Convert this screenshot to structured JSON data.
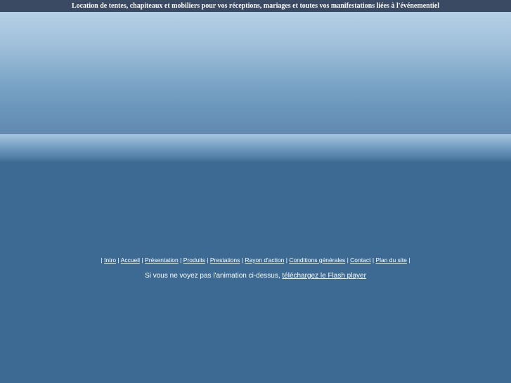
{
  "header": {
    "tagline": "Location de tentes, chapiteaux et mobiliers pour vos réceptions, mariages et toutes vos manifestations liées à l'événementiel"
  },
  "nav": {
    "separator": "|",
    "items": [
      {
        "label": "Intro"
      },
      {
        "label": "Accueil"
      },
      {
        "label": "Présentation"
      },
      {
        "label": "Produits"
      },
      {
        "label": "Prestations"
      },
      {
        "label": "Rayon d'action"
      },
      {
        "label": "Conditions générales"
      },
      {
        "label": "Contact"
      },
      {
        "label": "Plan du site"
      }
    ]
  },
  "flash": {
    "text": "Si vous ne voyez pas l'animation ci-dessus,",
    "link_label": "téléchargez le Flash player"
  },
  "colors": {
    "top_bar": "#3a4a63",
    "background": "#3c6a92",
    "text": "#ffffff"
  }
}
